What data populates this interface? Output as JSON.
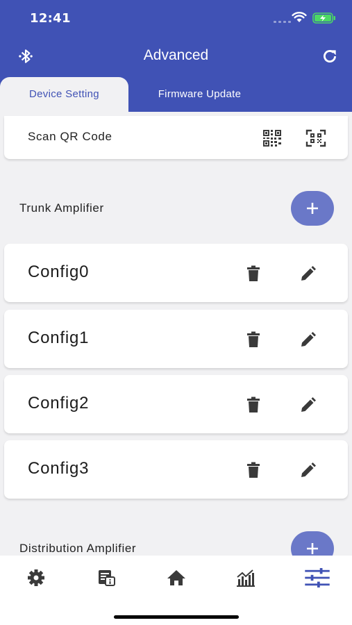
{
  "status_bar": {
    "time": "12:41"
  },
  "app_bar": {
    "title": "Advanced",
    "left_icon": "bluetooth-icon",
    "right_icon": "refresh-icon"
  },
  "tabs": [
    {
      "label": "Device Setting",
      "active": true
    },
    {
      "label": "Firmware Update",
      "active": false
    }
  ],
  "scan": {
    "label": "Scan QR Code",
    "icons": [
      "qr-code-icon",
      "qr-scan-icon"
    ]
  },
  "sections": [
    {
      "title": "Trunk Amplifier",
      "configs": [
        "Config0",
        "Config1",
        "Config2",
        "Config3"
      ]
    },
    {
      "title": "Distribution Amplifier",
      "configs": []
    }
  ],
  "bottom_nav": {
    "items": [
      "settings-icon",
      "device-info-icon",
      "home-icon",
      "chart-icon",
      "tune-icon"
    ],
    "active": "tune-icon"
  },
  "colors": {
    "primary": "#4052b5",
    "fab": "#6a78c8",
    "background": "#f1f1f3",
    "icon_dark": "#3a3a3a"
  }
}
